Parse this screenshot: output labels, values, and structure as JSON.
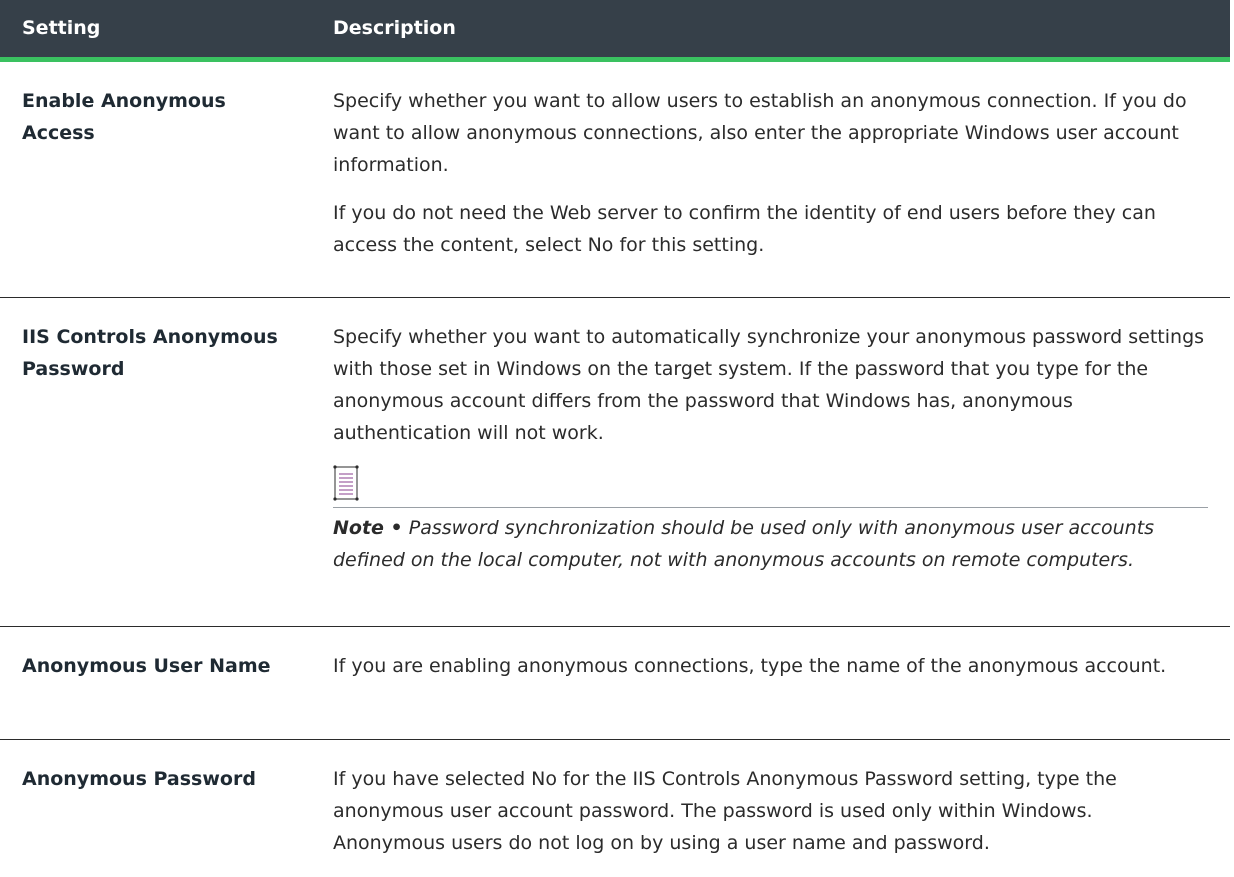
{
  "table": {
    "headers": {
      "setting": "Setting",
      "description": "Description"
    },
    "rows": [
      {
        "setting": "Enable Anonymous Access",
        "paragraphs": [
          "Specify whether you want to allow users to establish an anonymous connection. If you do want to allow anonymous connections, also enter the appropriate Windows user account information.",
          "If you do not need the Web server to confirm the identity of end users before they can access the content, select No for this setting."
        ]
      },
      {
        "setting": "IIS Controls Anonymous Password",
        "paragraphs": [
          "Specify whether you want to automatically synchronize your anonymous password settings with those set in Windows on the target system. If the password that you type for the anonymous account differs from the password that Windows has, anonymous authentication will not work."
        ],
        "note": {
          "icon": "note-icon",
          "label": "Note •",
          "text": "Password synchronization should be used only with anonymous user accounts defined on the local computer, not with anonymous accounts on remote computers."
        }
      },
      {
        "setting": "Anonymous User Name",
        "paragraphs": [
          "If you are enabling anonymous connections, type the name of the anonymous account."
        ]
      },
      {
        "setting": "Anonymous Password",
        "paragraphs": [
          "If you have selected No for the IIS Controls Anonymous Password setting, type the anonymous user account password. The password is used only within Windows. Anonymous users do not log on by using a user name and password."
        ]
      }
    ]
  },
  "colors": {
    "header_bg": "#364049",
    "header_accent": "#3ac160",
    "note_icon": "#8a3f8f"
  }
}
